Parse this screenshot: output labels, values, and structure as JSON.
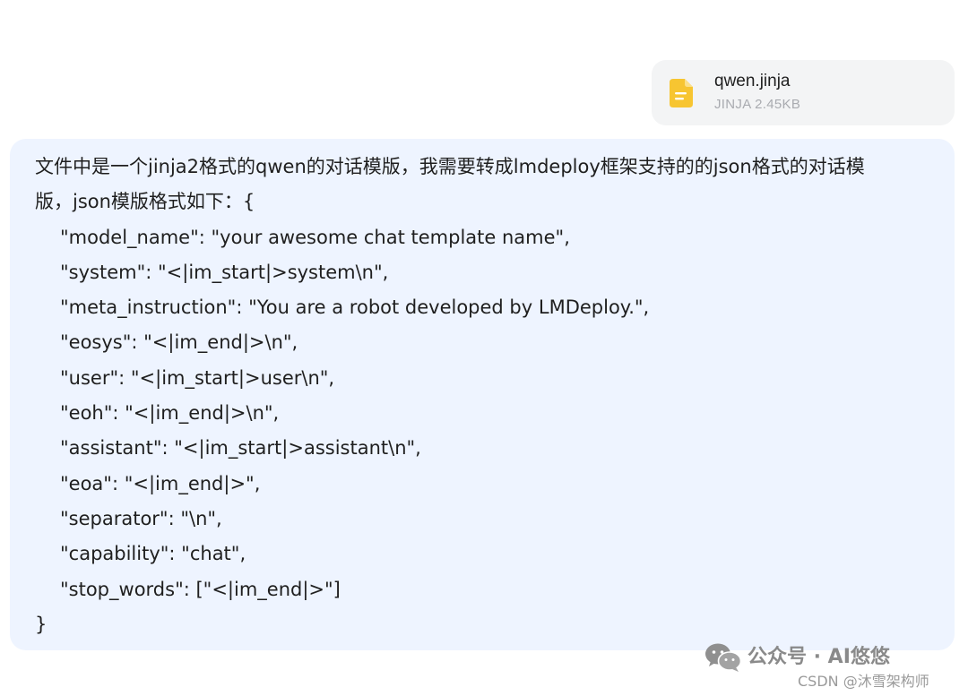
{
  "attachment": {
    "file_name": "qwen.jinja",
    "file_meta": "JINJA 2.45KB",
    "icon": "document-icon",
    "icon_color": "#f7c531"
  },
  "message": {
    "lines": [
      "文件中是一个jinja2格式的qwen的对话模版，我需要转成lmdeploy框架支持的的json格式的对话模",
      "版，json模版格式如下：{",
      "\"model_name\": \"your awesome chat template name\",",
      "\"system\": \"<|im_start|>system\\n\",",
      "\"meta_instruction\": \"You are a robot developed by LMDeploy.\",",
      "\"eosys\": \"<|im_end|>\\n\",",
      "\"user\": \"<|im_start|>user\\n\",",
      "\"eoh\": \"<|im_end|>\\n\",",
      "\"assistant\": \"<|im_start|>assistant\\n\",",
      "\"eoa\": \"<|im_end|>\",",
      "\"separator\": \"\\n\",",
      "\"capability\": \"chat\",",
      "\"stop_words\": [\"<|im_end|>\"]",
      "}"
    ],
    "bubble_color": "#eef4ff"
  },
  "watermark": {
    "account": "公众号 · AI悠悠",
    "source": "CSDN @沐雪架构师",
    "icon": "wechat-icon"
  }
}
